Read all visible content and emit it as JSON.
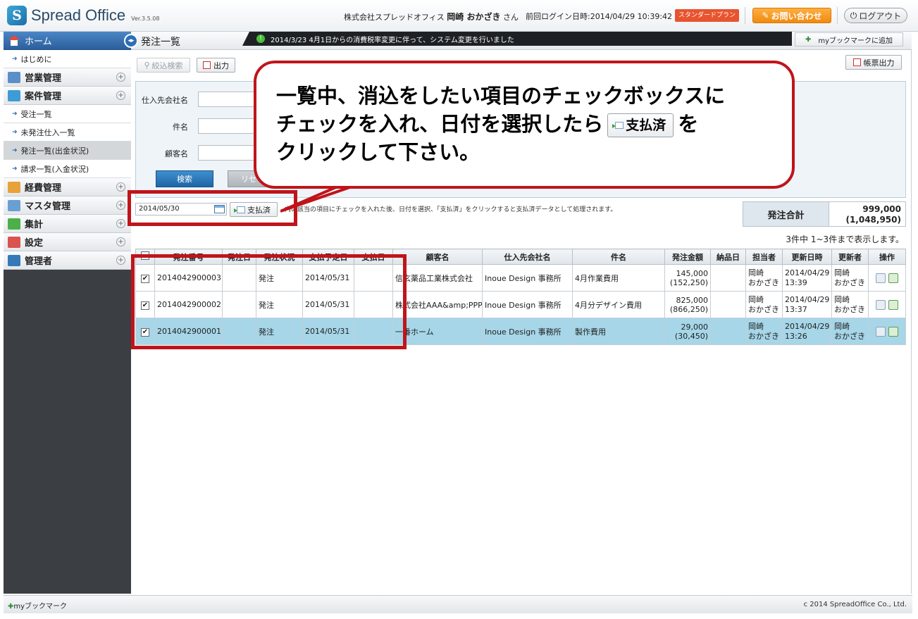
{
  "header": {
    "app_name": "Spread Office",
    "version": "Ver.3.5.08",
    "company": "株式会社スプレッドオフィス",
    "user_name": "岡崎 おかざき",
    "user_suffix": "さん",
    "last_login_label": "前回ログイン日時:",
    "last_login": "2014/04/29 10:39:42",
    "plan": "スタンダードプラン",
    "inquiry": "お問い合わせ",
    "logout": "ログアウト"
  },
  "sidebar": {
    "home": "ホーム",
    "items": [
      {
        "type": "sub",
        "label": "はじめに"
      },
      {
        "type": "cat",
        "label": "営業管理",
        "color": "#5a8fc8"
      },
      {
        "type": "cat",
        "label": "案件管理",
        "color": "#3e9bd6"
      },
      {
        "type": "sub",
        "label": "受注一覧"
      },
      {
        "type": "sub",
        "label": "未発注仕入一覧"
      },
      {
        "type": "sub",
        "label": "発注一覧(出金状況)",
        "active": true
      },
      {
        "type": "sub",
        "label": "請求一覧(入金状況)"
      },
      {
        "type": "cat",
        "label": "経費管理",
        "color": "#e7a23a"
      },
      {
        "type": "cat",
        "label": "マスタ管理",
        "color": "#6a9fd4"
      },
      {
        "type": "cat",
        "label": "集計",
        "color": "#4cb04a"
      },
      {
        "type": "cat",
        "label": "設定",
        "color": "#d9534f"
      },
      {
        "type": "cat",
        "label": "管理者",
        "color": "#3479b8"
      }
    ]
  },
  "page": {
    "title": "発注一覧",
    "news": "2014/3/23  4月1日からの消費税率変更に伴って、システム変更を行いました",
    "bookmark_add": "myブックマークに追加",
    "filter_button": "絞込検索",
    "export_button": "出力",
    "report_button": "帳票出力"
  },
  "search": {
    "supplier_label": "仕入先会社名",
    "subject_label": "件名",
    "customer_label": "顧客名",
    "search_button": "検索",
    "reset_button": "リセ"
  },
  "action": {
    "date_value": "2014/05/30",
    "paid_button": "支払済",
    "note": "内の該当の項目にチェックを入れた後、日付を選択、「支払済」をクリックすると支払済データとして処理されます。"
  },
  "totals": {
    "label": "発注合計",
    "amount": "999,000",
    "amount_tax": "(1,048,950)"
  },
  "count_text": "3件中 1~3件まで表示します。",
  "table": {
    "headers": [
      "",
      "発注番号",
      "発注日",
      "発注状況",
      "支払予定日",
      "支払日",
      "顧客名",
      "仕入先会社名",
      "件名",
      "発注金額",
      "納品日",
      "担当者",
      "更新日時",
      "更新者",
      "操作"
    ],
    "rows": [
      {
        "checked": "✔",
        "no": "2014042900003H",
        "order_date": "",
        "status": "発注",
        "pay_due": "2014/05/31",
        "pay_date": "",
        "customer": "信玄薬品工業株式会社",
        "supplier": "Inoue Design 事務所",
        "subject": "4月作業費用",
        "amount": "145,000",
        "amount_tax": "(152,250)",
        "delivery": "",
        "staff1": "岡崎",
        "staff2": "おかざき",
        "upd_date": "2014/04/29",
        "upd_time": "13:39",
        "upd1": "岡崎",
        "upd2": "おかざき",
        "selected": false
      },
      {
        "checked": "✔",
        "no": "2014042900002H",
        "order_date": "",
        "status": "発注",
        "pay_due": "2014/05/31",
        "pay_date": "",
        "customer": "株式会社AAA&amp;PPP",
        "supplier": "Inoue Design 事務所",
        "subject": "4月分デザイン費用",
        "amount": "825,000",
        "amount_tax": "(866,250)",
        "delivery": "",
        "staff1": "岡崎",
        "staff2": "おかざき",
        "upd_date": "2014/04/29",
        "upd_time": "13:37",
        "upd1": "岡崎",
        "upd2": "おかざき",
        "selected": false
      },
      {
        "checked": "✔",
        "no": "2014042900001H",
        "order_date": "",
        "status": "発注",
        "pay_due": "2014/05/31",
        "pay_date": "",
        "customer": "一番ホーム",
        "supplier": "Inoue Design 事務所",
        "subject": "製作費用",
        "amount": "29,000",
        "amount_tax": "(30,450)",
        "delivery": "",
        "staff1": "岡崎",
        "staff2": "おかざき",
        "upd_date": "2014/04/29",
        "upd_time": "13:26",
        "upd1": "岡崎",
        "upd2": "おかざき",
        "selected": true
      }
    ]
  },
  "footer": {
    "bookmark": "myブックマーク",
    "copyright": "c 2014 SpreadOffice Co., Ltd."
  },
  "callout": {
    "line1": "一覧中、消込をしたい項目のチェックボックスに",
    "line2a": "チェックを入れ、日付を選択したら",
    "line2_button": "支払済",
    "line2b": "を",
    "line3": "クリックして下さい。"
  },
  "colors": {
    "annotation_red": "#c0141b",
    "selected_row": "#a6d6e8",
    "primary_blue": "#1e66a6"
  }
}
